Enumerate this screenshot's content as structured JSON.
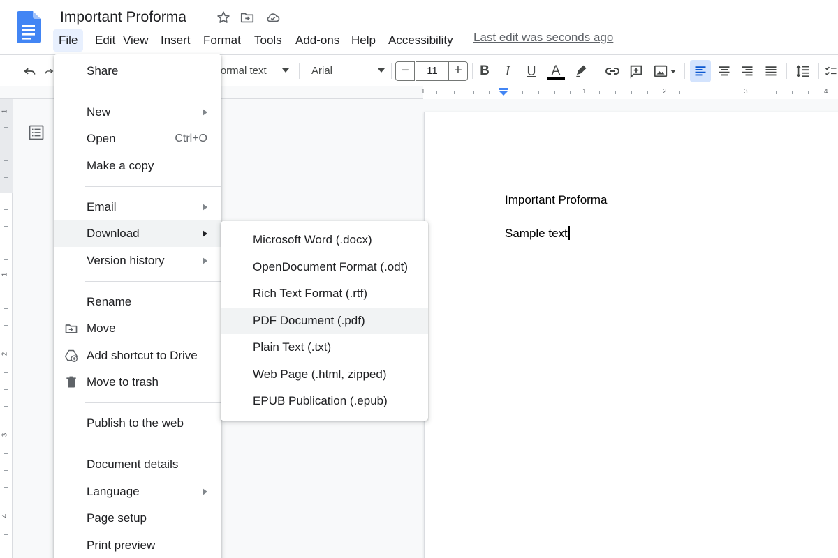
{
  "app": {
    "doc_title": "Important Proforma",
    "last_edit": "Last edit was seconds ago"
  },
  "menubar": {
    "items": [
      "File",
      "Edit",
      "View",
      "Insert",
      "Format",
      "Tools",
      "Add-ons",
      "Help",
      "Accessibility"
    ],
    "active": "File"
  },
  "toolbar": {
    "style_value": "Normal text",
    "font_value": "Arial",
    "font_size": "11",
    "decrease_label": "−",
    "increase_label": "+",
    "bold_label": "B",
    "italic_label": "I",
    "underline_label": "U",
    "text_color_label": "A",
    "text_color": "#000000",
    "active_alignment": "align-left"
  },
  "ruler": {
    "numbers": [
      "1",
      "1",
      "2",
      "3",
      "4"
    ]
  },
  "vertical_ruler": {
    "numbers": [
      "1",
      "1",
      "2",
      "3",
      "4"
    ]
  },
  "document": {
    "lines": [
      "Important Proforma",
      "Sample text"
    ]
  },
  "file_menu": {
    "share": "Share",
    "new": "New",
    "open": "Open",
    "open_shortcut": "Ctrl+O",
    "make_copy": "Make a copy",
    "email": "Email",
    "download": "Download",
    "version_history": "Version history",
    "rename": "Rename",
    "move": "Move",
    "add_shortcut": "Add shortcut to Drive",
    "move_to_trash": "Move to trash",
    "publish": "Publish to the web",
    "document_details": "Document details",
    "language": "Language",
    "page_setup": "Page setup",
    "print_preview": "Print preview",
    "highlighted": "Download"
  },
  "download_menu": {
    "items": [
      "Microsoft Word (.docx)",
      "OpenDocument Format (.odt)",
      "Rich Text Format (.rtf)",
      "PDF Document (.pdf)",
      "Plain Text (.txt)",
      "Web Page (.html, zipped)",
      "EPUB Publication (.epub)"
    ],
    "highlighted": "PDF Document (.pdf)"
  },
  "colors": {
    "docs_blue": "#4285f4",
    "menu_active_bg": "#e8f0fe",
    "hover_bg": "#f1f3f4",
    "align_active_bg": "#d3e3fd"
  }
}
